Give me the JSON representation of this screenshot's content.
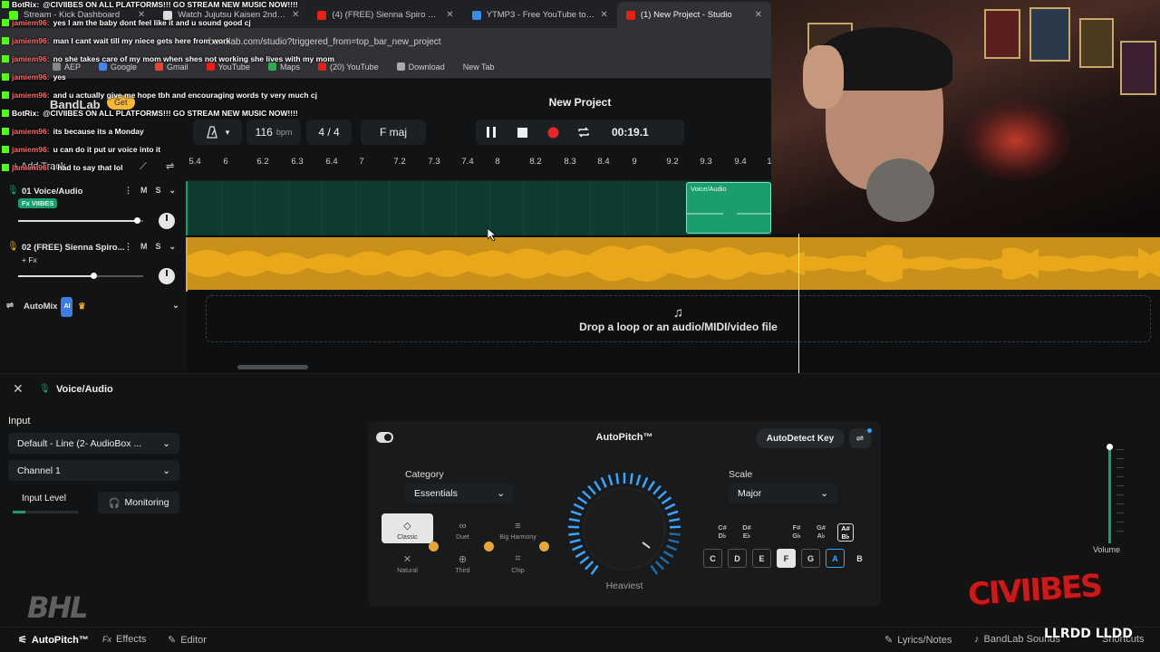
{
  "browser": {
    "tabs": [
      {
        "label": "Stream - Kick Dashboard",
        "color": "#53fc18",
        "active": false
      },
      {
        "label": "Watch Jujutsu Kaisen 2nd Seas",
        "color": "#dddddd",
        "active": false
      },
      {
        "label": "(4) (FREE) Sienna Spiro Type Be",
        "color": "#e62117",
        "active": false
      },
      {
        "label": "YTMP3 - Free YouTube to MP3",
        "color": "#3b8be8",
        "active": false
      },
      {
        "label": "(1) New Project - Studio",
        "color": "#e62117",
        "active": true
      }
    ],
    "url": "bandlab.com/studio?triggered_from=top_bar_new_project",
    "bookmarks": [
      {
        "label": "AEP",
        "color": "#888888"
      },
      {
        "label": "Google",
        "color": "#4285f4"
      },
      {
        "label": "Gmail",
        "color": "#ea4335"
      },
      {
        "label": "YouTube",
        "color": "#e62117"
      },
      {
        "label": "Maps",
        "color": "#34a853"
      },
      {
        "label": "(20) YouTube",
        "color": "#e62117"
      },
      {
        "label": "Download",
        "color": "#aaaaaa"
      },
      {
        "label": "New Tab",
        "color": ""
      }
    ]
  },
  "chat": [
    {
      "user": "BotRix:",
      "text": "@CIVIIBES ON ALL PLATFORMS!!! GO STREAM NEW MUSIC NOW!!!!",
      "user_color": "#ffffff"
    },
    {
      "user": "jamiem96:",
      "text": "yes I am the baby dont feel like it and u sound good cj",
      "user_color": "#ff6b6b"
    },
    {
      "user": "jamiem96:",
      "text": "man I cant wait till my niece gets here from work",
      "user_color": "#ff6b6b"
    },
    {
      "user": "jamiem96:",
      "text": "no she takes care of my mom when shes not working she lives with my mom",
      "user_color": "#ff6b6b"
    },
    {
      "user": "jamiem96:",
      "text": "yes",
      "user_color": "#ff6b6b"
    },
    {
      "user": "jamiem96:",
      "text": "and u actually give me hope tbh and encouraging words ty very much cj",
      "user_color": "#ff6b6b"
    },
    {
      "user": "BotRix:",
      "text": "@CIVIIBES ON ALL PLATFORMS!!! GO STREAM NEW MUSIC NOW!!!!",
      "user_color": "#ffffff"
    },
    {
      "user": "jamiem96:",
      "text": "its because its a Monday",
      "user_color": "#ff6b6b"
    },
    {
      "user": "jamiem96:",
      "text": "u can do it put ur voice into it",
      "user_color": "#ff6b6b"
    },
    {
      "user": "jamiem96:",
      "text": "I had to say that lol",
      "user_color": "#ff6b6b"
    }
  ],
  "studio": {
    "brand": "BandLab",
    "get_label": "Get",
    "project_title": "New Project",
    "tempo": "116",
    "tempo_unit": "bpm",
    "time_signature": "4 / 4",
    "key": "F maj",
    "time": "00:19.1",
    "add_track": "Add Track",
    "ruler_ticks": [
      "5.4",
      "6",
      "6.2",
      "6.3",
      "6.4",
      "7",
      "7.2",
      "7.3",
      "7.4",
      "8",
      "8.2",
      "8.3",
      "8.4",
      "9",
      "9.2",
      "9.3",
      "9.4",
      "1"
    ],
    "tracks": [
      {
        "name": "01  Voice/Audio",
        "fx": "Fx VIIBES",
        "volume": 0.95,
        "color": "#1c9d6e"
      },
      {
        "name": "02  (FREE) Sienna Spiro...",
        "fx": "+ Fx",
        "volume": 0.6,
        "color": "#e6a63a"
      }
    ],
    "clip_label": "Voice/Audio",
    "automix": "AutoMix",
    "ai_badge": "AI",
    "drop_text": "Drop a loop or an audio/MIDI/video file",
    "accent": "#1c9d6e",
    "waveform_color": "#f7b21c"
  },
  "panel": {
    "title": "Voice/Audio",
    "input_label": "Input",
    "input_device": "Default - Line (2- AudioBox ...",
    "channel": "Channel 1",
    "input_level": "Input Level",
    "input_level_value": 0.2,
    "monitoring": "Monitoring",
    "autopitch_title": "AutoPitch™",
    "autodetect": "AutoDetect Key",
    "category_label": "Category",
    "category_value": "Essentials",
    "presets": [
      {
        "label": "Classic",
        "icon": "◇",
        "selected": true,
        "locked": false
      },
      {
        "label": "Duet",
        "icon": "∞",
        "selected": false,
        "locked": false
      },
      {
        "label": "Big Harmony",
        "icon": "≡",
        "selected": false,
        "locked": false
      },
      {
        "label": "Natural",
        "icon": "✕",
        "selected": false,
        "locked": true
      },
      {
        "label": "Third",
        "icon": "⊕",
        "selected": false,
        "locked": true
      },
      {
        "label": "Chip",
        "icon": "⌗",
        "selected": false,
        "locked": true
      }
    ],
    "knob_label": "Heaviest",
    "scale_label": "Scale",
    "scale_value": "Major",
    "sharps": [
      {
        "top": "C#",
        "bottom": "D♭",
        "selected": false
      },
      {
        "top": "D#",
        "bottom": "E♭",
        "selected": false
      },
      {
        "top": "F#",
        "bottom": "G♭",
        "selected": false
      },
      {
        "top": "G#",
        "bottom": "A♭",
        "selected": false
      },
      {
        "top": "A#",
        "bottom": "B♭",
        "selected": true
      }
    ],
    "naturals": [
      {
        "label": "C",
        "state": "on"
      },
      {
        "label": "D",
        "state": "on"
      },
      {
        "label": "E",
        "state": "on"
      },
      {
        "label": "F",
        "state": "selected"
      },
      {
        "label": "G",
        "state": "on"
      },
      {
        "label": "A",
        "state": "key"
      },
      {
        "label": "B",
        "state": "off"
      }
    ],
    "volume_label": "Volume"
  },
  "bottom_bar": {
    "autopitch": "AutoPitch™",
    "effects": "Effects",
    "editor": "Editor",
    "lyrics": "Lyrics/Notes",
    "sounds": "BandLab Sounds",
    "shortcuts": "Shortcuts"
  },
  "overlay": {
    "webcam_label": "webcam",
    "watermark_left": "BHL",
    "watermark_right": "CIVIIBES",
    "tag": "LLRDD LLDD"
  }
}
